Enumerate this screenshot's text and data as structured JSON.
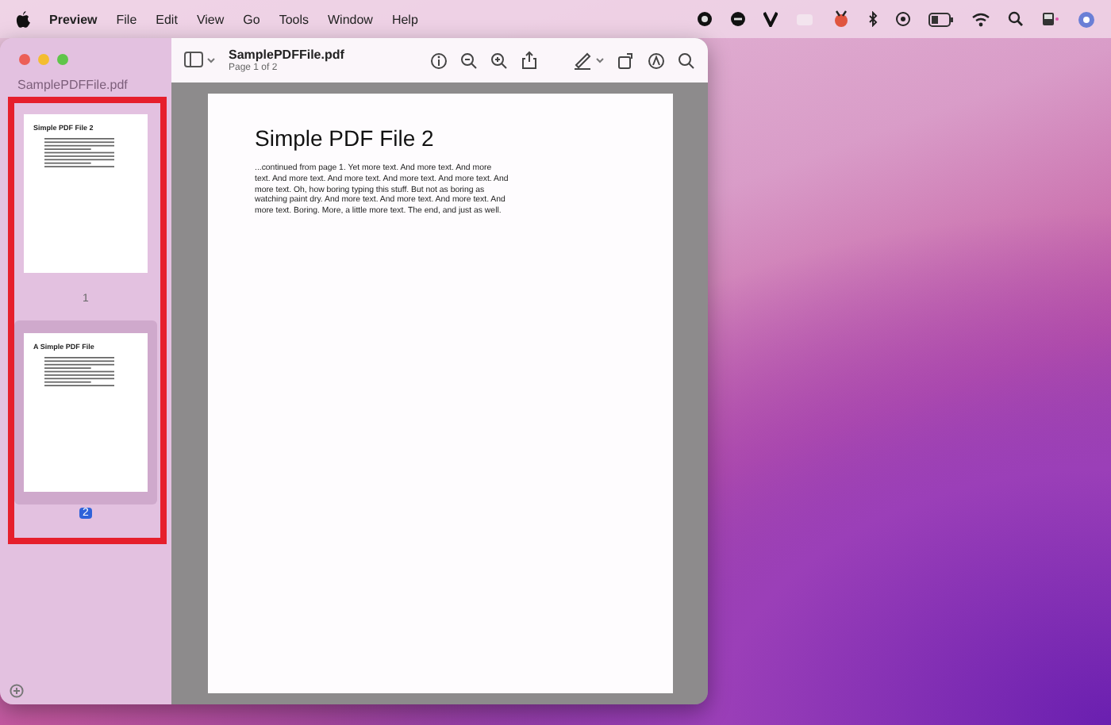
{
  "menu_bar": {
    "app_name": "Preview",
    "items": [
      "File",
      "Edit",
      "View",
      "Go",
      "Tools",
      "Window",
      "Help"
    ]
  },
  "window": {
    "title": "SamplePDFFile.pdf",
    "subtitle": "Page 1 of 2"
  },
  "sidebar": {
    "heading": "SamplePDFFile.pdf",
    "thumbnails": [
      {
        "title": "Simple PDF File 2",
        "page_label": "1",
        "selected": false
      },
      {
        "title": "A Simple PDF File",
        "page_label": "2",
        "selected": true
      }
    ]
  },
  "document": {
    "heading": "Simple PDF File 2",
    "body": "...continued from page 1. Yet more text. And more text. And more text. And more text. And more text. And more text. And more text. And more text. Oh, how boring typing this stuff. But not as boring as watching paint dry. And more text. And more text. And more text. And more text. Boring.  More, a little more text. The end, and just as well."
  }
}
